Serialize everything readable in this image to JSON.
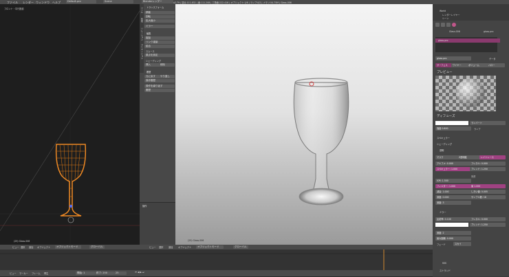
{
  "top_bar": {
    "menus": [
      "ファイル",
      "レンダー",
      "ウィンドウ",
      "ヘルプ"
    ],
    "layout_name": "Default.pro",
    "scene_name": "Scene",
    "engine": "Blenderレンダー",
    "info": "v2.79 | 頂点:111.832 | 面:111.208 | 三角面:222.416 | オブジェクト:1/6 | ランプ:0/2 | メモリ:54.75M | Glass.006"
  },
  "left_viewport": {
    "label": "フロント・平行投影",
    "object_label": "(25) Glass.006",
    "header": [
      "ビュー",
      "選択",
      "追加",
      "オブジェクト",
      "オブジェクトモード",
      "グローバル"
    ]
  },
  "tool_shelf": {
    "tabs": [
      "ツール",
      "作成",
      "リレーション",
      "アニメーション",
      "物理演算",
      "グリースペンシル"
    ],
    "transform_title": "トランスフォーム",
    "transform_buttons": [
      "移動",
      "回転",
      "拡大縮小",
      "ミラー"
    ],
    "edit_title": "編集",
    "edit_buttons": [
      "複製",
      "リンク複製",
      "結合"
    ],
    "edit_labels": [
      "スムース",
      "フラット",
      "原点を設定",
      "シェーディング",
      "キーフレーム",
      "挿入",
      "削除"
    ],
    "history_title": "履歴",
    "history_buttons": [
      "元に戻す",
      "やり直し",
      "操作履歴",
      "操作を繰り返す",
      "履歴"
    ],
    "operator_title": "操作"
  },
  "render_view": {
    "object_label": "(25) Glass.006",
    "header": [
      "ビュー",
      "選択",
      "追加",
      "オブジェクト",
      "オブジェクトモード",
      "グローバル"
    ]
  },
  "properties": {
    "outliner": [
      "World",
      "レンダーレイヤー",
      "シーン"
    ],
    "breadcrumb": [
      "Glass.006",
      "glass.pro"
    ],
    "material_slot": "glass.pro",
    "material_name": "glass.pro",
    "data_label": "データ",
    "tabs": [
      "サーフェス",
      "ワイヤー",
      "ボリューム",
      "ハロー"
    ],
    "preview_title": "プレビュー",
    "diffuse_title": "ディフューズ",
    "diffuse_shader": "ランバート",
    "intensity_label": "強度",
    "intensity_value": "0.800",
    "ramp_label": "ランプ",
    "specular_title": "スペキュラー",
    "shading_title": "シェーディング",
    "transparency_title": "透明",
    "transparency_modes": [
      "マスク",
      "Z透明度",
      "レイトレース"
    ],
    "alpha": "アルファ: 0.000",
    "specular_val": "スペキュラー: 1.000",
    "fresnel": "フレネル: 0.000",
    "blend": "ブレンド: 1.250",
    "ior": "IOR: 1.500",
    "filter": "フィルター: 1.000",
    "falloff": "減衰: 1.000",
    "depth": "深度: 0.000",
    "depth_limit": "深度: 3",
    "gloss_label": "光沢",
    "gloss_amount": "量",
    "gloss_value": "1.000",
    "threshold": "しきい値: 0.005",
    "samples": "サンプル数: 18",
    "mirror_title": "ミラー",
    "reflectivity": "反射率: 0.100",
    "mirror_fresnel": "フレネル: 0.000",
    "mirror_blend": "ブレンド: 1.250",
    "mirror_depth": "深度: 2",
    "max_dist": "最大距離: 0.000",
    "fade_to": "フェード",
    "fade_mode": "スカイ",
    "sss_title": "SSS",
    "strand_title": "ストランド"
  },
  "timeline": {
    "menu": [
      "ビュー",
      "マーカー",
      "フレーム",
      "再生"
    ],
    "start": "開始: 1",
    "end": "終了: 250",
    "current": "25"
  }
}
